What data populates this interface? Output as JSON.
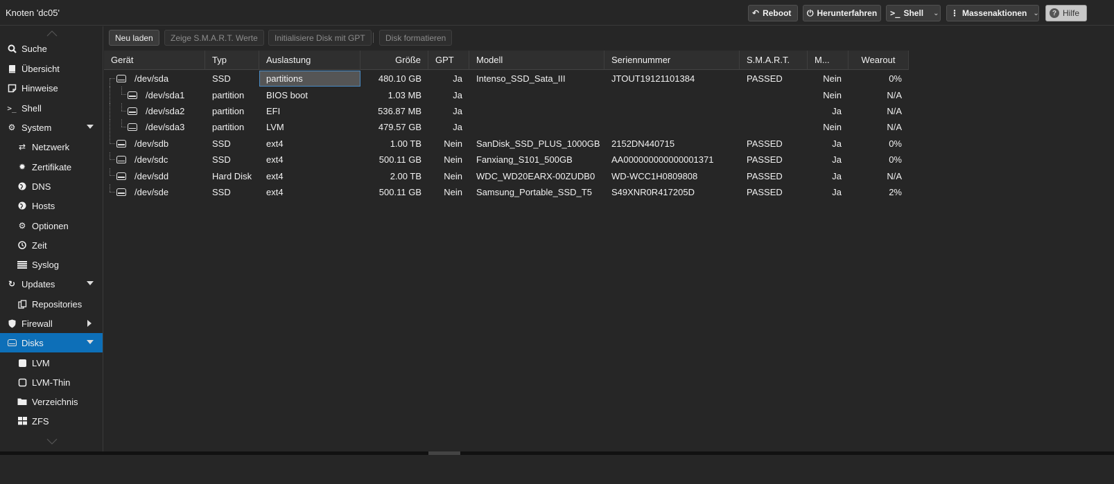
{
  "header": {
    "title": "Knoten 'dc05'",
    "buttons": {
      "reboot": "Reboot",
      "shutdown": "Herunterfahren",
      "shell": "Shell",
      "bulk": "Massenaktionen",
      "help": "Hilfe"
    }
  },
  "sidebar": {
    "items": [
      {
        "label": "Suche",
        "icon": "search-icon"
      },
      {
        "label": "Übersicht",
        "icon": "book-icon"
      },
      {
        "label": "Hinweise",
        "icon": "note-icon"
      },
      {
        "label": "Shell",
        "icon": "terminal-icon"
      },
      {
        "label": "System",
        "icon": "gears-icon"
      },
      {
        "label": "Netzwerk",
        "icon": "exchange-icon"
      },
      {
        "label": "Zertifikate",
        "icon": "certificate-icon"
      },
      {
        "label": "DNS",
        "icon": "globe-icon"
      },
      {
        "label": "Hosts",
        "icon": "globe-icon"
      },
      {
        "label": "Optionen",
        "icon": "gear-icon"
      },
      {
        "label": "Zeit",
        "icon": "clock-icon"
      },
      {
        "label": "Syslog",
        "icon": "list-icon"
      },
      {
        "label": "Updates",
        "icon": "refresh-icon"
      },
      {
        "label": "Repositories",
        "icon": "files-icon"
      },
      {
        "label": "Firewall",
        "icon": "shield-icon"
      },
      {
        "label": "Disks",
        "icon": "hdd-icon"
      },
      {
        "label": "LVM",
        "icon": "square-icon"
      },
      {
        "label": "LVM-Thin",
        "icon": "square-outline-icon"
      },
      {
        "label": "Verzeichnis",
        "icon": "folder-icon"
      },
      {
        "label": "ZFS",
        "icon": "grid-icon"
      }
    ]
  },
  "toolbar": {
    "reload": "Neu laden",
    "smart": "Zeige S.M.A.R.T. Werte",
    "init_gpt": "Initialisiere Disk mit GPT",
    "format": "Disk formatieren"
  },
  "grid": {
    "columns": [
      "Gerät",
      "Typ",
      "Auslastung",
      "Größe",
      "GPT",
      "Modell",
      "Seriennummer",
      "S.M.A.R.T.",
      "M...",
      "Wearout"
    ],
    "rows": [
      {
        "device": "/dev/sda",
        "type": "SSD",
        "usage": "partitions",
        "size": "480.10 GB",
        "gpt": "Ja",
        "model": "Intenso_SSD_Sata_III",
        "serial": "JTOUT19121101384",
        "smart": "PASSED",
        "mounted": "Nein",
        "wearout": "0%"
      },
      {
        "device": "/dev/sda1",
        "type": "partition",
        "usage": "BIOS boot",
        "size": "1.03 MB",
        "gpt": "Ja",
        "model": "",
        "serial": "",
        "smart": "",
        "mounted": "Nein",
        "wearout": "N/A"
      },
      {
        "device": "/dev/sda2",
        "type": "partition",
        "usage": "EFI",
        "size": "536.87 MB",
        "gpt": "Ja",
        "model": "",
        "serial": "",
        "smart": "",
        "mounted": "Ja",
        "wearout": "N/A"
      },
      {
        "device": "/dev/sda3",
        "type": "partition",
        "usage": "LVM",
        "size": "479.57 GB",
        "gpt": "Ja",
        "model": "",
        "serial": "",
        "smart": "",
        "mounted": "Nein",
        "wearout": "N/A"
      },
      {
        "device": "/dev/sdb",
        "type": "SSD",
        "usage": "ext4",
        "size": "1.00 TB",
        "gpt": "Nein",
        "model": "SanDisk_SSD_PLUS_1000GB",
        "serial": "2152DN440715",
        "smart": "PASSED",
        "mounted": "Ja",
        "wearout": "0%"
      },
      {
        "device": "/dev/sdc",
        "type": "SSD",
        "usage": "ext4",
        "size": "500.11 GB",
        "gpt": "Nein",
        "model": "Fanxiang_S101_500GB",
        "serial": "AA000000000000001371",
        "smart": "PASSED",
        "mounted": "Ja",
        "wearout": "0%"
      },
      {
        "device": "/dev/sdd",
        "type": "Hard Disk",
        "usage": "ext4",
        "size": "2.00 TB",
        "gpt": "Nein",
        "model": "WDC_WD20EARX-00ZUDB0",
        "serial": "WD-WCC1H0809808",
        "smart": "PASSED",
        "mounted": "Ja",
        "wearout": "N/A"
      },
      {
        "device": "/dev/sde",
        "type": "SSD",
        "usage": "ext4",
        "size": "500.11 GB",
        "gpt": "Nein",
        "model": "Samsung_Portable_SSD_T5",
        "serial": "S49XNR0R417205D",
        "smart": "PASSED",
        "mounted": "Ja",
        "wearout": "2%"
      }
    ]
  }
}
